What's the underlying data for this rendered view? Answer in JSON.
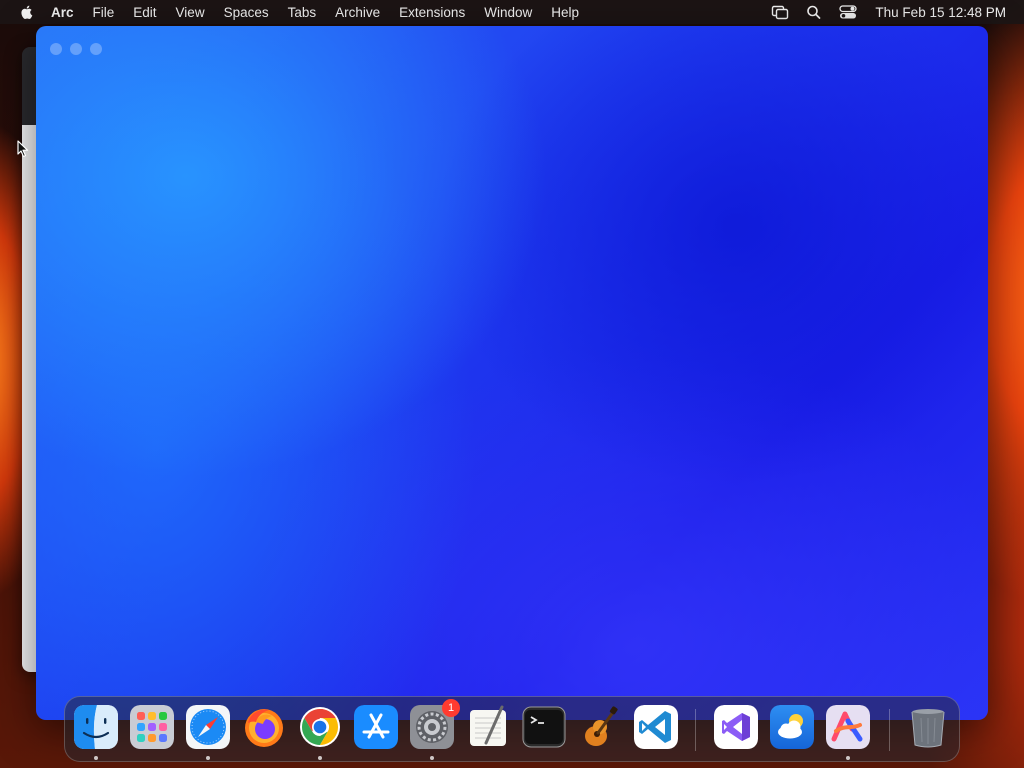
{
  "menubar": {
    "app_name": "Arc",
    "items": [
      "File",
      "Edit",
      "View",
      "Spaces",
      "Tabs",
      "Archive",
      "Extensions",
      "Window",
      "Help"
    ],
    "clock": "Thu Feb 15  12:48 PM",
    "status_icons": [
      "screen-mirroring-icon",
      "spotlight-search-icon",
      "control-center-icon"
    ]
  },
  "window": {
    "app": "Arc",
    "traffic_lights": [
      "close-button",
      "minimize-button",
      "zoom-button"
    ]
  },
  "dock": {
    "apps": [
      {
        "name": "Finder",
        "icon": "finder-icon",
        "running": true
      },
      {
        "name": "Launchpad",
        "icon": "launchpad-icon",
        "running": false
      },
      {
        "name": "Safari",
        "icon": "safari-icon",
        "running": true
      },
      {
        "name": "Firefox",
        "icon": "firefox-icon",
        "running": false
      },
      {
        "name": "Google Chrome",
        "icon": "chrome-icon",
        "running": true
      },
      {
        "name": "App Store",
        "icon": "app-store-icon",
        "running": false
      },
      {
        "name": "System Settings",
        "icon": "system-settings-icon",
        "running": true,
        "badge": "1"
      },
      {
        "name": "TextEdit",
        "icon": "textedit-icon",
        "running": false
      },
      {
        "name": "Terminal",
        "icon": "terminal-icon",
        "running": false
      },
      {
        "name": "GarageBand",
        "icon": "garageband-icon",
        "running": false
      },
      {
        "name": "Visual Studio Code",
        "icon": "vscode-icon",
        "running": false
      },
      {
        "name": "Visual Studio",
        "icon": "visual-studio-icon",
        "running": false
      },
      {
        "name": "Weather",
        "icon": "weather-icon",
        "running": false
      },
      {
        "name": "Arc",
        "icon": "arc-icon",
        "running": true
      },
      {
        "name": "Trash",
        "icon": "trash-icon",
        "running": false
      }
    ]
  }
}
